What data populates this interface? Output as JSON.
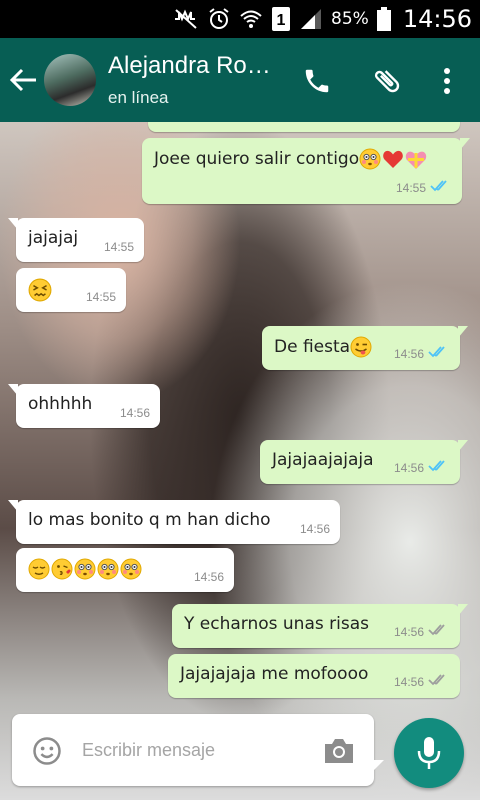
{
  "status_bar": {
    "battery": "85%",
    "time": "14:56",
    "sim": "1"
  },
  "header": {
    "contact_name": "Alejandra Ro…",
    "status": "en línea"
  },
  "messages": [
    {
      "dir": "out",
      "text": "Joee quiero salir contigo",
      "emoji": [
        "flushed",
        "heart",
        "gift-heart"
      ],
      "time": "14:55",
      "ticks": "read"
    },
    {
      "dir": "in",
      "text": "jajajaj",
      "emoji": [],
      "time": "14:55"
    },
    {
      "dir": "in",
      "text": "",
      "emoji": [
        "confounded"
      ],
      "time": "14:55"
    },
    {
      "dir": "out",
      "text": "De fiesta",
      "emoji": [
        "tongue-wink"
      ],
      "time": "14:56",
      "ticks": "read"
    },
    {
      "dir": "in",
      "text": "ohhhhh",
      "emoji": [],
      "time": "14:56"
    },
    {
      "dir": "out",
      "text": "Jajajaajajaja",
      "emoji": [],
      "time": "14:56",
      "ticks": "read"
    },
    {
      "dir": "in",
      "text": "lo mas bonito q m han dicho",
      "emoji": [],
      "time": "14:56"
    },
    {
      "dir": "in",
      "text": "",
      "emoji": [
        "relieved",
        "kiss-wink",
        "flushed",
        "flushed",
        "flushed"
      ],
      "time": "14:56"
    },
    {
      "dir": "out",
      "text": "Y echarnos unas risas",
      "emoji": [],
      "time": "14:56",
      "ticks": "delivered"
    },
    {
      "dir": "out",
      "text": "Jajajajaja me mofoooo",
      "emoji": [],
      "time": "14:56",
      "ticks": "delivered"
    }
  ],
  "composer": {
    "placeholder": "Escribir mensaje"
  },
  "colors": {
    "header": "#075e54",
    "outgoing": "#dcf8c6",
    "incoming": "#ffffff",
    "mic": "#128c7e",
    "read_ticks": "#4fc3f7",
    "sent_ticks": "#9e9e9e"
  }
}
